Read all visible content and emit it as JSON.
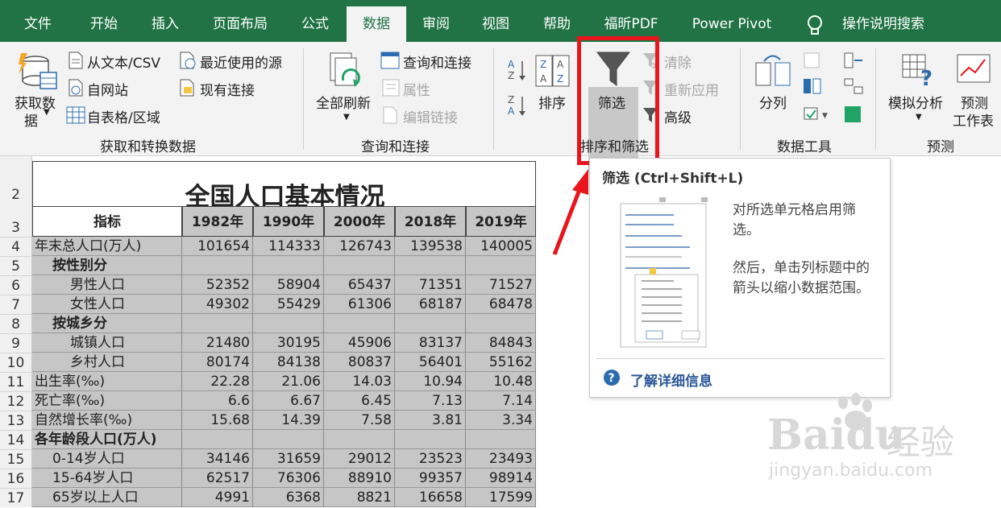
{
  "tabs": [
    "文件",
    "开始",
    "插入",
    "页面布局",
    "公式",
    "数据",
    "审阅",
    "视图",
    "帮助",
    "福昕PDF",
    "Power Pivot",
    "操作说明搜索"
  ],
  "ribbon": {
    "get_data": "获取数",
    "get_data2": "据",
    "from_text": "从文本/CSV",
    "recent_sources": "最近使用的源",
    "from_web": "自网站",
    "existing_conn": "现有连接",
    "from_table": "自表格/区域",
    "group1": "获取和转换数据",
    "refresh_all": "全部刷新",
    "queries_conn": "查询和连接",
    "properties": "属性",
    "edit_links": "编辑链接",
    "group2": "查询和连接",
    "sort": "排序",
    "filter": "筛选",
    "clear": "清除",
    "reapply": "重新应用",
    "advanced": "高级",
    "group3": "排序和筛选",
    "text_to_cols": "分列",
    "group4": "数据工具",
    "whatif": "模拟分析",
    "forecast1": "预测",
    "forecast2": "工作表",
    "group5": "预测"
  },
  "tooltip": {
    "title": "筛选 (Ctrl+Shift+L)",
    "desc1": "对所选单元格启用筛",
    "desc2": "选。",
    "desc3": "然后，单击列标题中的",
    "desc4": "箭头以缩小数据范围。",
    "more_info": "了解详细信息"
  },
  "sheet": {
    "title": "全国人口基本情况",
    "headers": [
      "指标",
      "1982年",
      "1990年",
      "2000年",
      "2018年",
      "2019年"
    ],
    "rows": [
      {
        "n": "4",
        "label": "年末总人口(万人)",
        "indent": 0,
        "bold": false,
        "vals": [
          "101654",
          "114333",
          "126743",
          "139538",
          "140005"
        ]
      },
      {
        "n": "5",
        "label": "按性别分",
        "indent": 1,
        "bold": true,
        "vals": [
          "",
          "",
          "",
          "",
          ""
        ]
      },
      {
        "n": "6",
        "label": "男性人口",
        "indent": 2,
        "bold": false,
        "vals": [
          "52352",
          "58904",
          "65437",
          "71351",
          "71527"
        ]
      },
      {
        "n": "7",
        "label": "女性人口",
        "indent": 2,
        "bold": false,
        "vals": [
          "49302",
          "55429",
          "61306",
          "68187",
          "68478"
        ]
      },
      {
        "n": "8",
        "label": "按城乡分",
        "indent": 1,
        "bold": true,
        "vals": [
          "",
          "",
          "",
          "",
          ""
        ]
      },
      {
        "n": "9",
        "label": "城镇人口",
        "indent": 2,
        "bold": false,
        "vals": [
          "21480",
          "30195",
          "45906",
          "83137",
          "84843"
        ]
      },
      {
        "n": "10",
        "label": "乡村人口",
        "indent": 2,
        "bold": false,
        "vals": [
          "80174",
          "84138",
          "80837",
          "56401",
          "55162"
        ]
      },
      {
        "n": "11",
        "label": "出生率(‰)",
        "indent": 0,
        "bold": false,
        "vals": [
          "22.28",
          "21.06",
          "14.03",
          "10.94",
          "10.48"
        ]
      },
      {
        "n": "12",
        "label": "死亡率(‰)",
        "indent": 0,
        "bold": false,
        "vals": [
          "6.6",
          "6.67",
          "6.45",
          "7.13",
          "7.14"
        ]
      },
      {
        "n": "13",
        "label": "自然增长率(‰)",
        "indent": 0,
        "bold": false,
        "vals": [
          "15.68",
          "14.39",
          "7.58",
          "3.81",
          "3.34"
        ]
      },
      {
        "n": "14",
        "label": "各年龄段人口(万人)",
        "indent": 0,
        "bold": true,
        "vals": [
          "",
          "",
          "",
          "",
          ""
        ]
      },
      {
        "n": "15",
        "label": "0-14岁人口",
        "indent": 1,
        "bold": false,
        "vals": [
          "34146",
          "31659",
          "29012",
          "23523",
          "23493"
        ]
      },
      {
        "n": "16",
        "label": "15-64岁人口",
        "indent": 1,
        "bold": false,
        "vals": [
          "62517",
          "76306",
          "88910",
          "99357",
          "98914"
        ]
      },
      {
        "n": "17",
        "label": "65岁以上人口",
        "indent": 1,
        "bold": false,
        "vals": [
          "4991",
          "6368",
          "8821",
          "16658",
          "17599"
        ]
      }
    ]
  },
  "watermark": {
    "brand": "Baidu",
    "brand2": "经验",
    "url": "jingyan.baidu.com"
  },
  "colors": {
    "excel_green": "#217346",
    "highlight_red": "#e8161c",
    "arrow_red": "#e8161c"
  }
}
